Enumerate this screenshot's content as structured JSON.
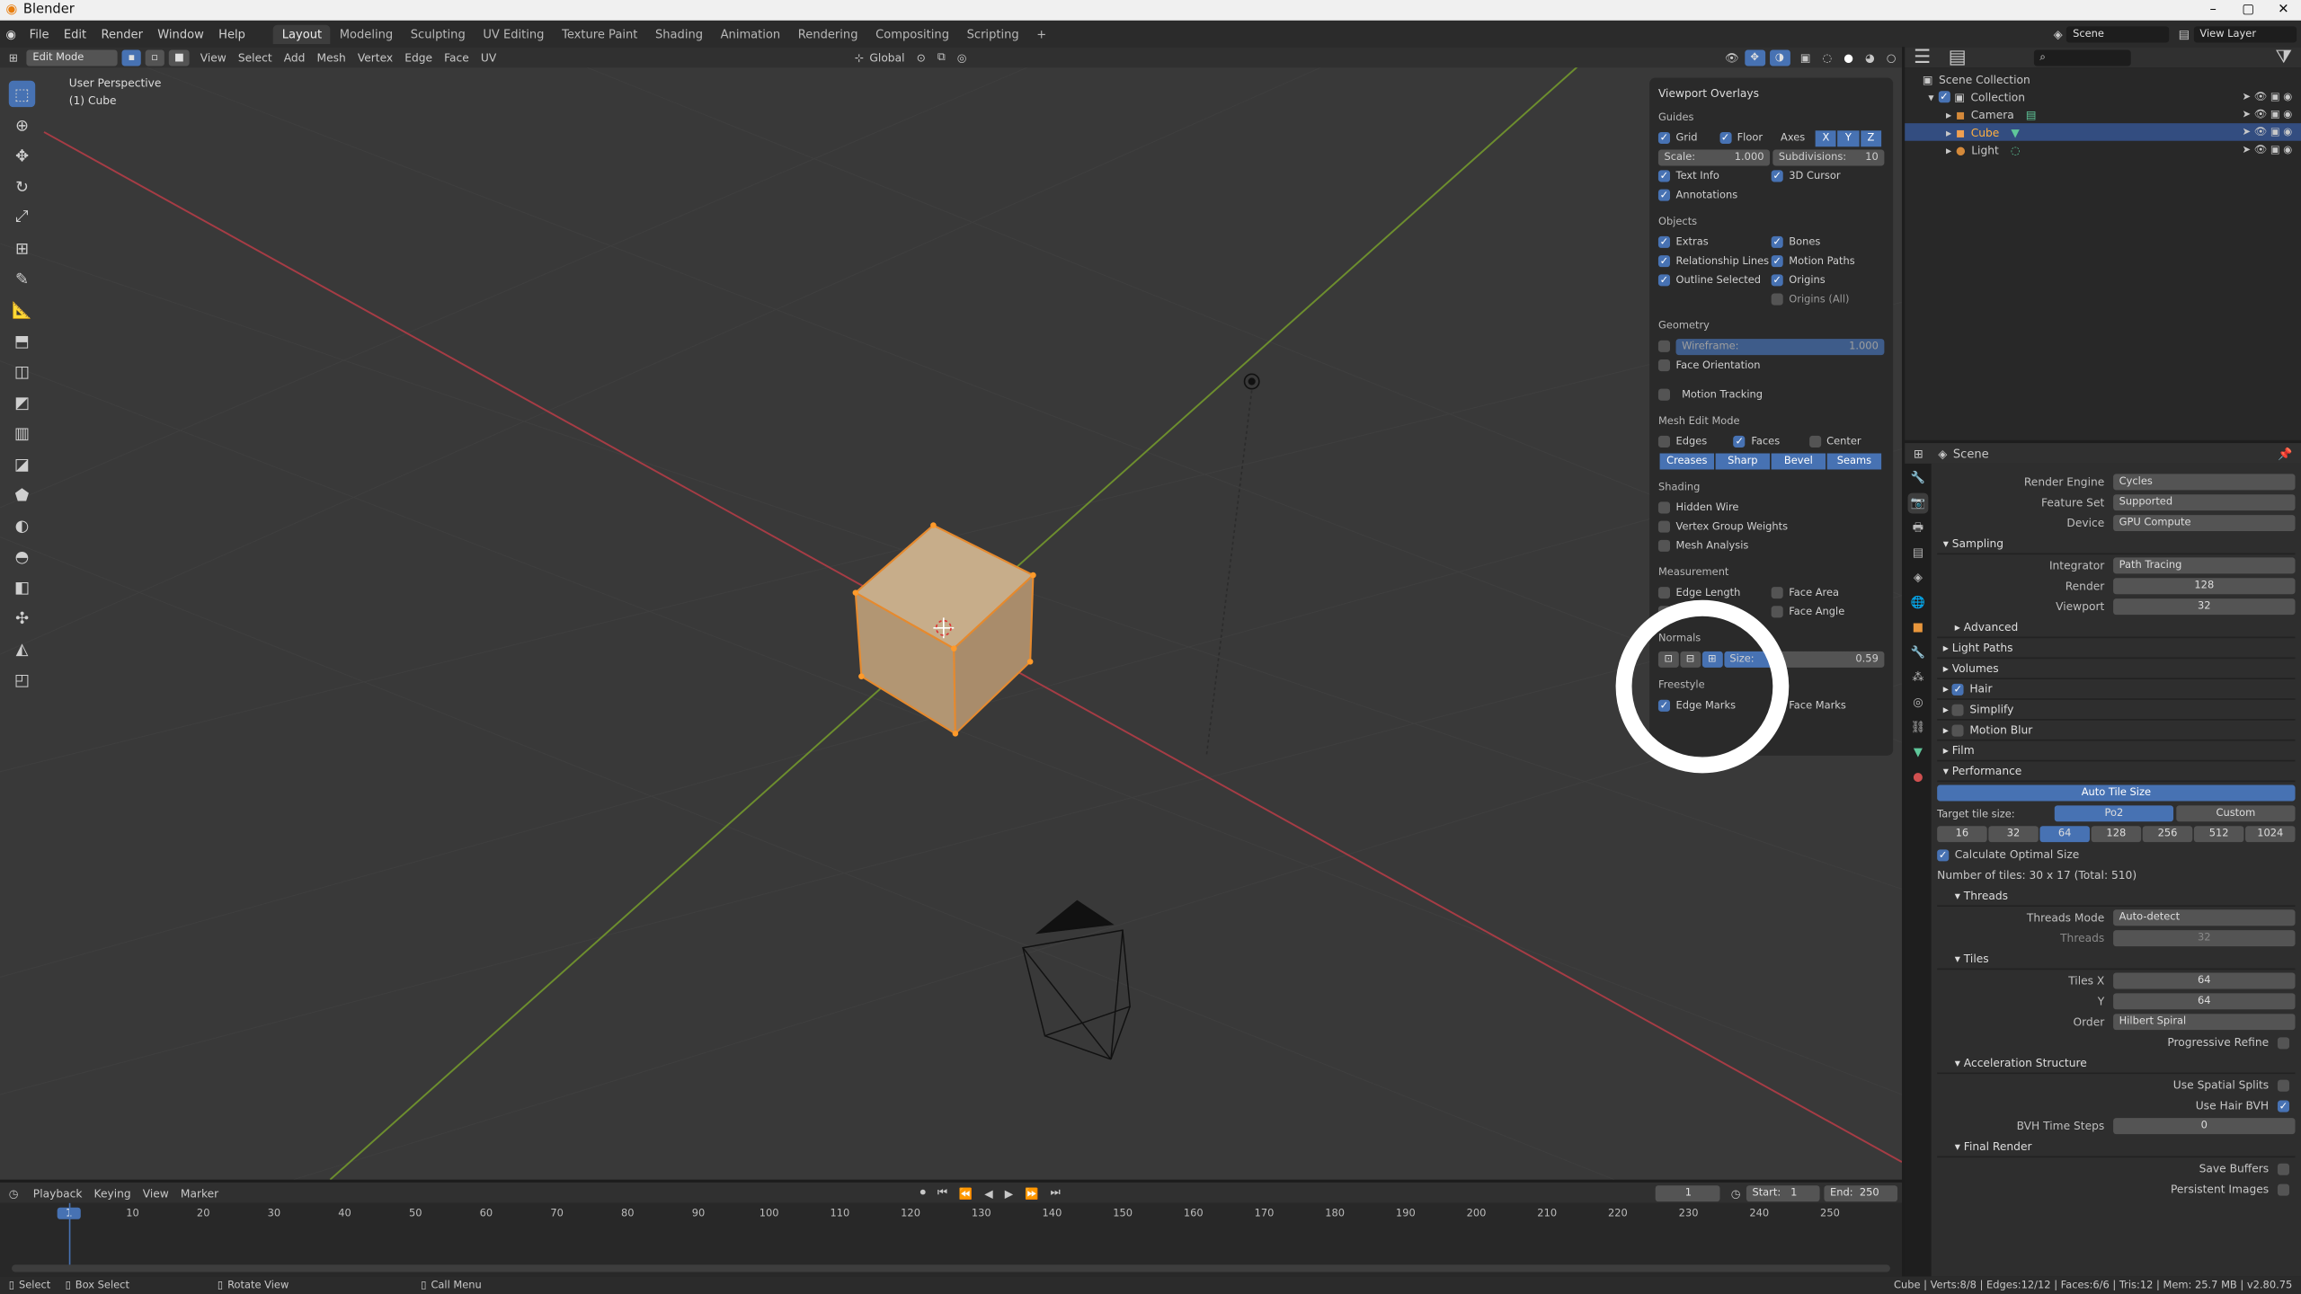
{
  "app": {
    "title": "Blender"
  },
  "menu": [
    "File",
    "Edit",
    "Render",
    "Window",
    "Help"
  ],
  "workspaces": [
    {
      "label": "Layout",
      "active": true
    },
    {
      "label": "Modeling"
    },
    {
      "label": "Sculpting"
    },
    {
      "label": "UV Editing"
    },
    {
      "label": "Texture Paint"
    },
    {
      "label": "Shading"
    },
    {
      "label": "Animation"
    },
    {
      "label": "Rendering"
    },
    {
      "label": "Compositing"
    },
    {
      "label": "Scripting"
    }
  ],
  "top_right": {
    "scene": "Scene",
    "view_layer": "View Layer"
  },
  "view3d": {
    "mode": "Edit Mode",
    "menus": [
      "View",
      "Select",
      "Add",
      "Mesh",
      "Vertex",
      "Edge",
      "Face",
      "UV"
    ],
    "orientation": "Global",
    "perspective": "User Perspective",
    "object_label": "(1) Cube"
  },
  "overlays": {
    "title": "Viewport Overlays",
    "guides": "Guides",
    "grid": "Grid",
    "floor": "Floor",
    "axes": "Axes",
    "x": "X",
    "y": "Y",
    "z": "Z",
    "scale_label": "Scale:",
    "scale_value": "1.000",
    "subdiv_label": "Subdivisions:",
    "subdiv_value": "10",
    "text_info": "Text Info",
    "cursor3d": "3D Cursor",
    "annotations": "Annotations",
    "objects": "Objects",
    "extras": "Extras",
    "bones": "Bones",
    "relationship": "Relationship Lines",
    "motion_paths": "Motion Paths",
    "outline_selected": "Outline Selected",
    "origins": "Origins",
    "origins_all": "Origins (All)",
    "geometry": "Geometry",
    "wireframe": "Wireframe:",
    "wireframe_value": "1.000",
    "face_orientation": "Face Orientation",
    "motion_tracking": "Motion Tracking",
    "mesh_edit": "Mesh Edit Mode",
    "edges": "Edges",
    "faces": "Faces",
    "center": "Center",
    "creases": "Creases",
    "sharp": "Sharp",
    "bevel": "Bevel",
    "seams": "Seams",
    "shading": "Shading",
    "hidden_wire": "Hidden Wire",
    "vgroup_weights": "Vertex Group Weights",
    "mesh_analysis": "Mesh Analysis",
    "measurement": "Measurement",
    "edge_length": "Edge Length",
    "face_area": "Face Area",
    "edge_angle": "Edge Angle",
    "face_angle": "Face Angle",
    "normals": "Normals",
    "size_label": "Size:",
    "size_value": "0.59",
    "freestyle": "Freestyle",
    "edge_marks": "Edge Marks",
    "face_marks": "Face Marks"
  },
  "outliner": {
    "rows": [
      "Scene Collection",
      "Collection",
      "Camera",
      "Cube",
      "Light"
    ]
  },
  "props": {
    "context": "Scene",
    "render_engine_label": "Render Engine",
    "render_engine": "Cycles",
    "feature_set_label": "Feature Set",
    "feature_set": "Supported",
    "device_label": "Device",
    "device": "GPU Compute",
    "sampling": "Sampling",
    "integrator_label": "Integrator",
    "integrator": "Path Tracing",
    "render_label": "Render",
    "render": "128",
    "viewport_label": "Viewport",
    "viewport": "32",
    "advanced": "Advanced",
    "light_paths": "Light Paths",
    "volumes": "Volumes",
    "hair": "Hair",
    "simplify": "Simplify",
    "motion_blur": "Motion Blur",
    "film": "Film",
    "performance": "Performance",
    "auto_tile": "Auto Tile Size",
    "target_tile": "Target tile size:",
    "po2": "Po2",
    "custom": "Custom",
    "tiles": [
      "16",
      "32",
      "64",
      "128",
      "256",
      "512",
      "1024"
    ],
    "calc_optimal": "Calculate Optimal Size",
    "num_tiles": "Number of tiles: 30 x 17 (Total: 510)",
    "threads": "Threads",
    "threads_mode_label": "Threads Mode",
    "threads_mode": "Auto-detect",
    "threads_label": "Threads",
    "threads_value": "32",
    "tiles_sec": "Tiles",
    "tiles_x_label": "Tiles X",
    "tiles_x": "64",
    "tiles_y_label": "Y",
    "tiles_y": "64",
    "order_label": "Order",
    "order": "Hilbert Spiral",
    "progressive": "Progressive Refine",
    "accel": "Acceleration Structure",
    "spatial_splits": "Use Spatial Splits",
    "hair_bvh": "Use Hair BVH",
    "bvh_steps_label": "BVH Time Steps",
    "bvh_steps": "0",
    "final_render": "Final Render",
    "save_buffers": "Save Buffers",
    "persistent_images": "Persistent Images"
  },
  "timeline": {
    "menus": [
      "Playback",
      "Keying",
      "View",
      "Marker"
    ],
    "current": "1",
    "start_label": "Start:",
    "start": "1",
    "end_label": "End:",
    "end": "250",
    "ticks": [
      "1",
      "10",
      "20",
      "30",
      "40",
      "50",
      "60",
      "70",
      "80",
      "90",
      "100",
      "110",
      "120",
      "130",
      "140",
      "150",
      "160",
      "170",
      "180",
      "190",
      "200",
      "210",
      "220",
      "230",
      "240",
      "250"
    ]
  },
  "status": {
    "select": "Select",
    "box_select": "Box Select",
    "rotate_view": "Rotate View",
    "call_menu": "Call Menu",
    "stats": "Cube | Verts:8/8 | Edges:12/12 | Faces:6/6 | Tris:12 | Mem: 25.7 MB | v2.80.75"
  }
}
